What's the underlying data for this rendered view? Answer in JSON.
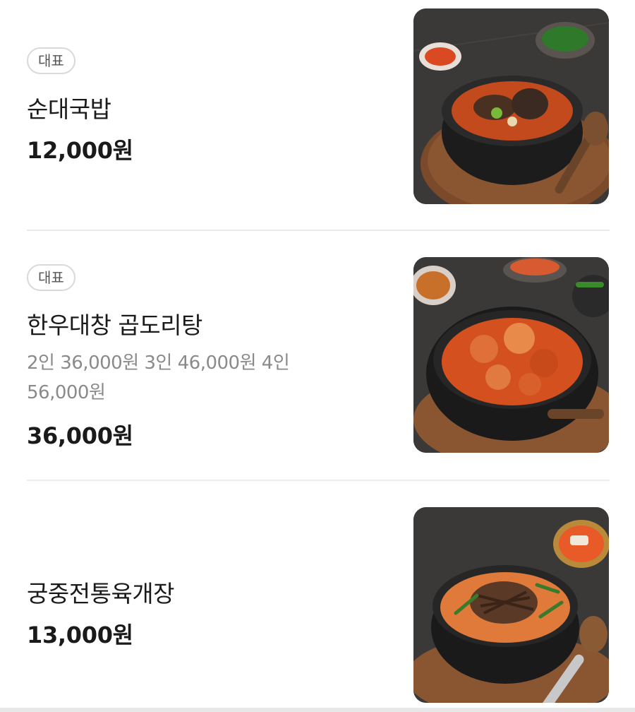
{
  "menu": {
    "items": [
      {
        "badge": "대표",
        "name": "순대국밥",
        "description": "",
        "price": "12,000원",
        "image_icon": "sundae-gukbap-photo"
      },
      {
        "badge": "대표",
        "name": "한우대창 곱도리탕",
        "description": "2인 36,000원 3인 46,000원 4인 56,000원",
        "price": "36,000원",
        "image_icon": "gopdori-tang-photo"
      },
      {
        "badge": "",
        "name": "궁중전통육개장",
        "description": "",
        "price": "13,000원",
        "image_icon": "yukgaejang-photo"
      }
    ]
  },
  "colors": {
    "text_primary": "#1a1a1a",
    "text_secondary": "#8a8a8a",
    "badge_border": "#d9d9d9",
    "divider": "#ebebeb",
    "photo_background": "#3a3836"
  }
}
